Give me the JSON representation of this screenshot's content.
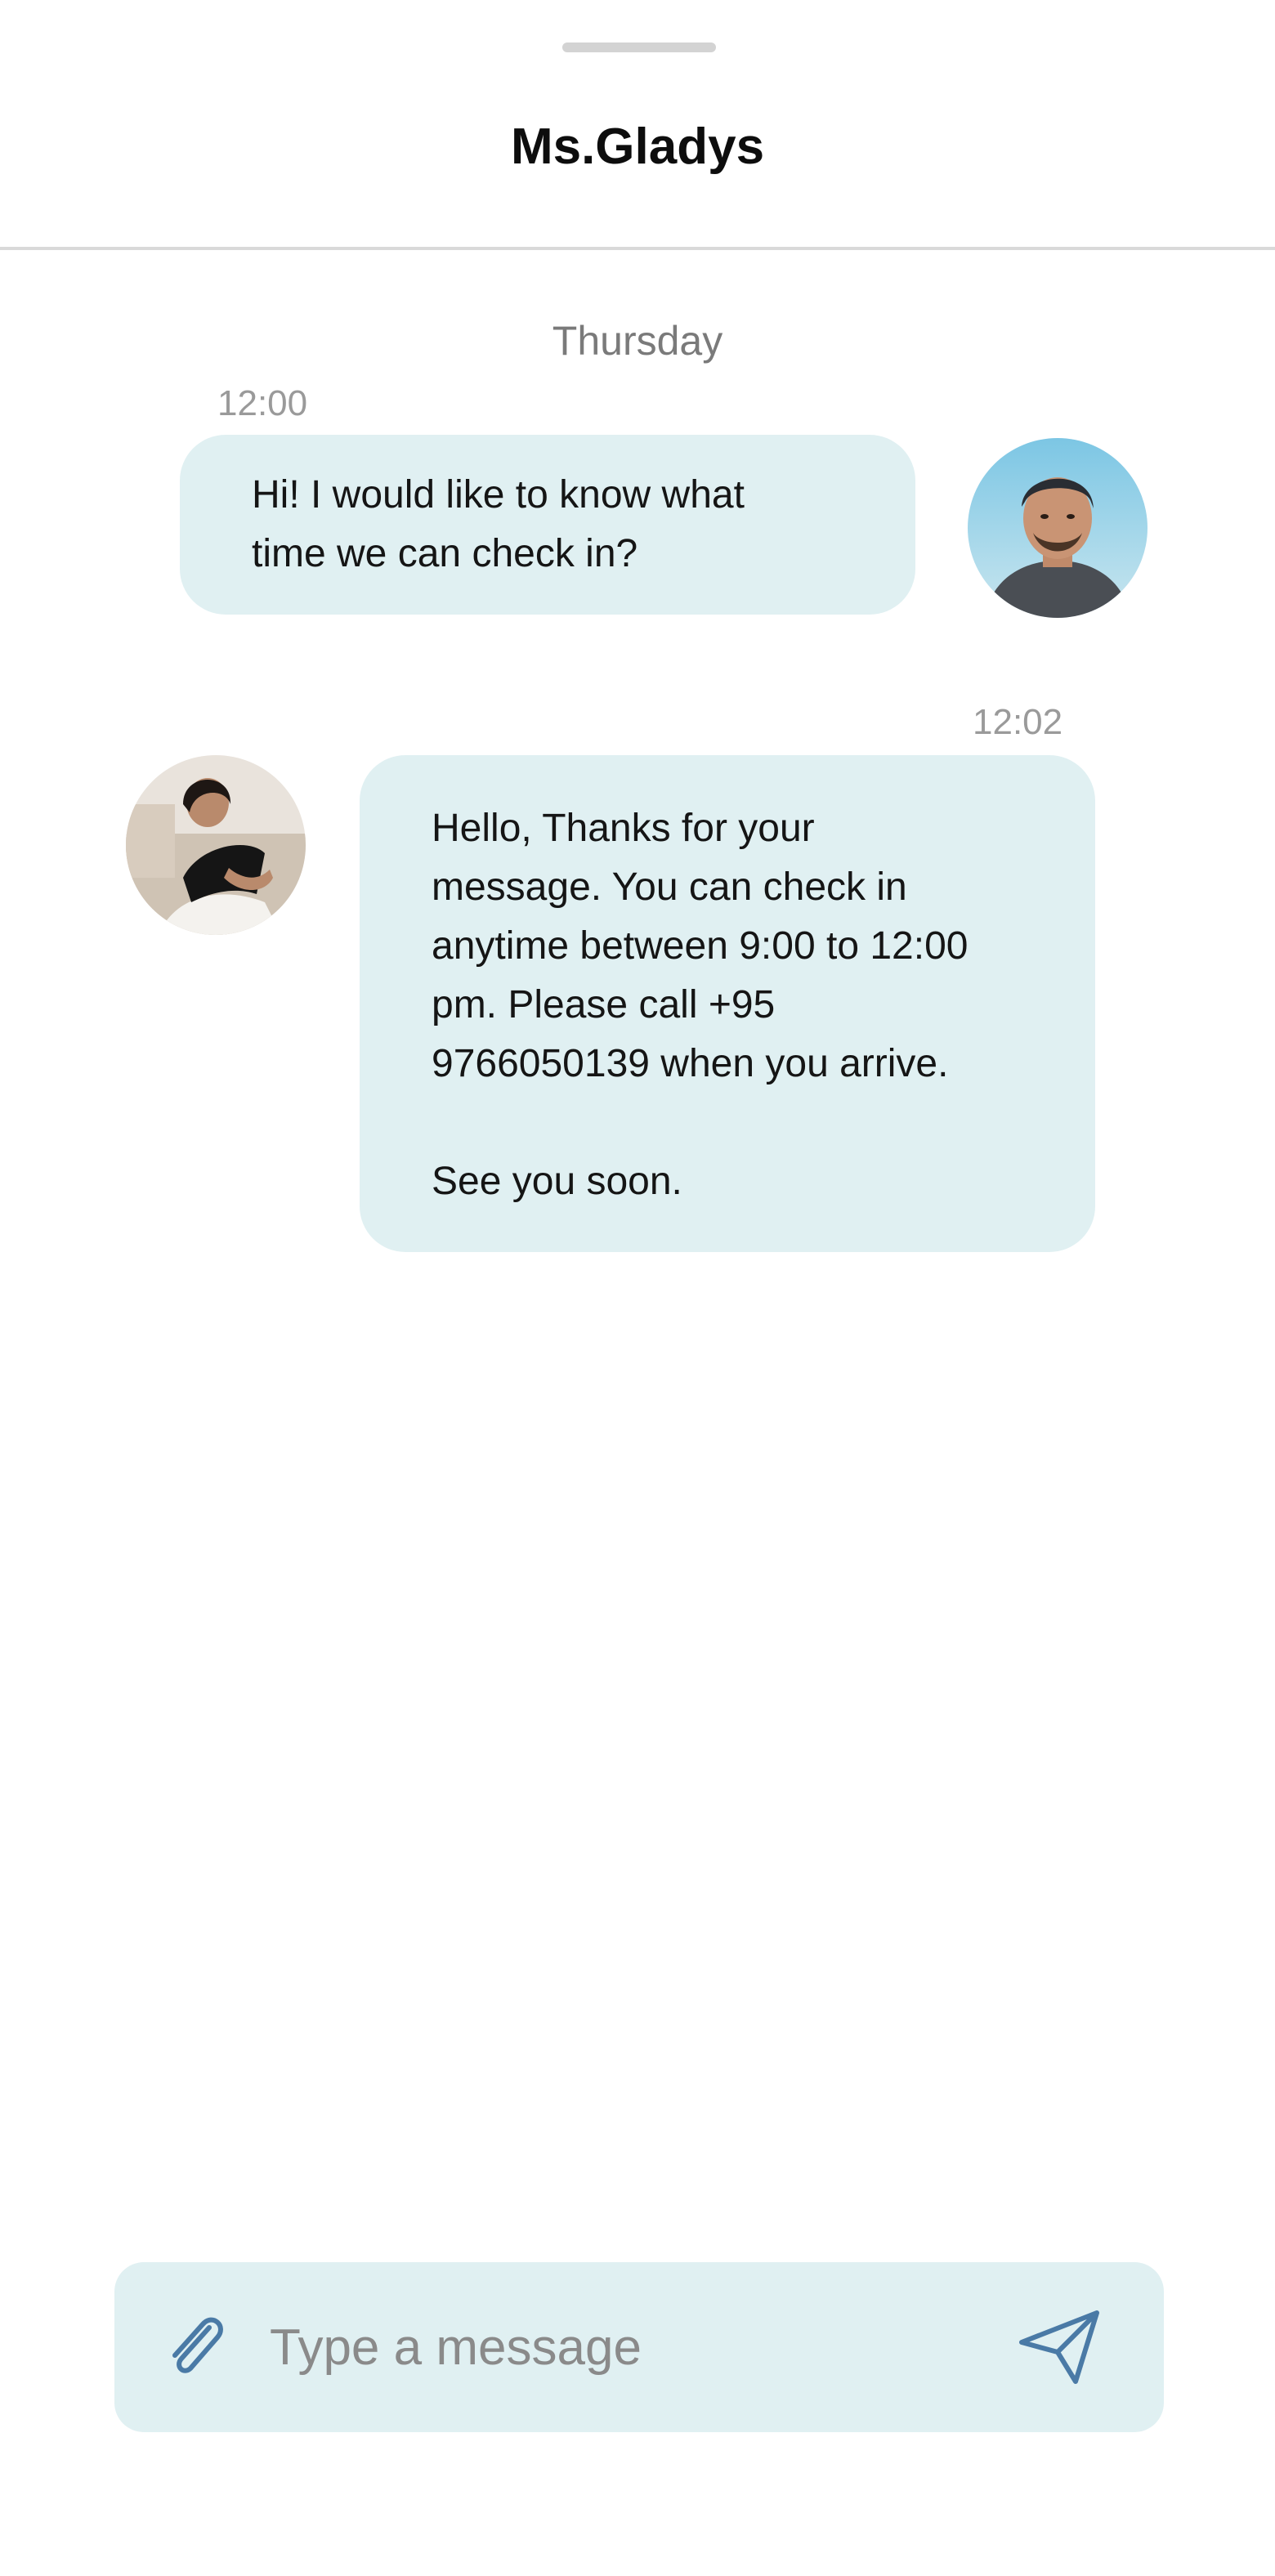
{
  "header": {
    "title": "Ms.Gladys"
  },
  "conversation": {
    "day_label": "Thursday",
    "messages": [
      {
        "time": "12:00",
        "text": "Hi! I would like to know what\ntime we can check in?",
        "avatar_icon": "user-avatar"
      },
      {
        "time": "12:02",
        "text": "Hello, Thanks for your\nmessage. You can check in\nanytime between 9:00 to 12:00\npm. Please call +95\n9766050139 when you arrive.\n\nSee you soon.",
        "avatar_icon": "host-avatar"
      }
    ]
  },
  "composer": {
    "placeholder": "Type a message",
    "value": "",
    "attach_icon": "paperclip-icon",
    "send_icon": "send-icon"
  },
  "colors": {
    "bubble_bg": "#e0f0f2",
    "composer_bg": "#e0f0f2",
    "icon_color": "#4a7aa6",
    "timestamp": "#9a9a9a"
  }
}
